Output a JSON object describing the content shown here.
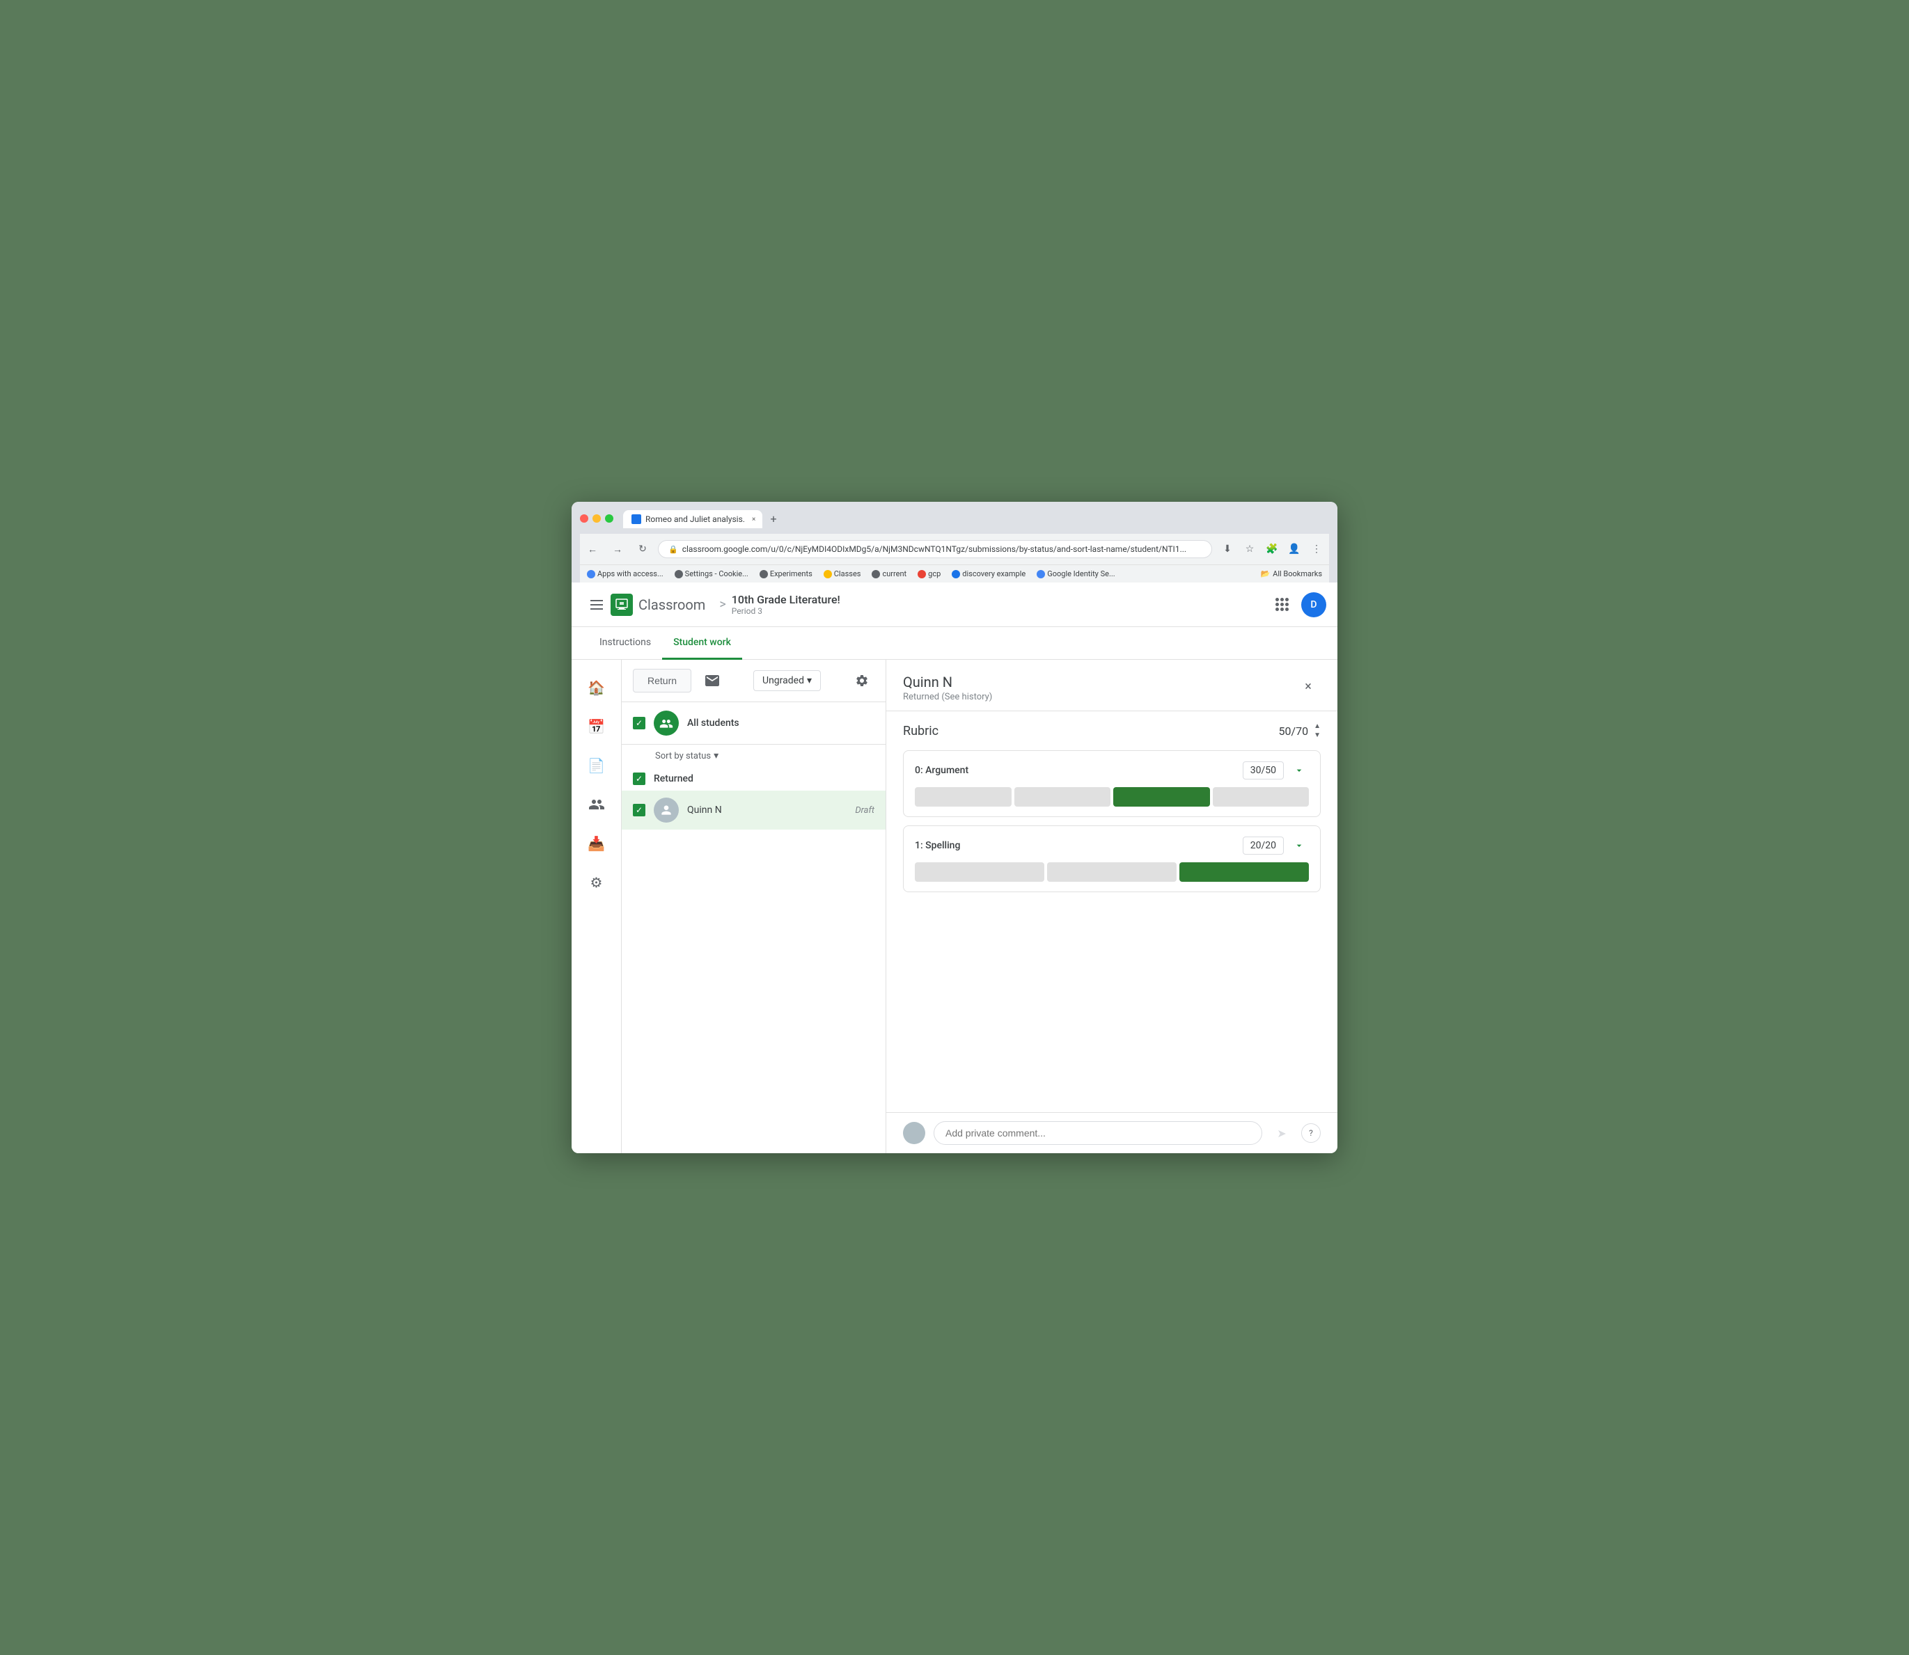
{
  "browser": {
    "tab_title": "Romeo and Juliet analysis.",
    "tab_close": "×",
    "new_tab": "+",
    "url": "classroom.google.com/u/0/c/NjEyMDI4ODIxMDg5/a/NjM3NDcwNTQ1NTgz/submissions/by-status/and-sort-last-name/student/NTI1...",
    "back_btn": "←",
    "forward_btn": "→",
    "refresh_btn": "↻",
    "bookmarks": [
      {
        "label": "Apps with access...",
        "color": "#4285f4"
      },
      {
        "label": "Settings - Cookie...",
        "color": "#5f6368"
      },
      {
        "label": "Experiments",
        "color": "#5f6368"
      },
      {
        "label": "Classes",
        "color": "#fbbc04"
      },
      {
        "label": "current",
        "color": "#5f6368"
      },
      {
        "label": "gcp",
        "color": "#ea4335"
      },
      {
        "label": "discovery example",
        "color": "#1a73e8"
      },
      {
        "label": "Google Identity Se...",
        "color": "#4285f4"
      }
    ],
    "all_bookmarks": "All Bookmarks"
  },
  "app_bar": {
    "app_name": "Classroom",
    "breadcrumb_separator": ">",
    "course_name": "10th Grade Literature!",
    "course_period": "Period 3",
    "user_initial": "D"
  },
  "tabs": [
    {
      "label": "Instructions",
      "active": false
    },
    {
      "label": "Student work",
      "active": true
    }
  ],
  "toolbar": {
    "return_label": "Return",
    "email_icon": "✉",
    "grade_label": "Ungraded",
    "dropdown_icon": "▾",
    "settings_icon": "⚙"
  },
  "student_list": {
    "all_students_label": "All students",
    "sort_label": "Sort by status",
    "sort_icon": "▾",
    "section_returned": "Returned",
    "students": [
      {
        "name": "Quinn N",
        "status": "Draft",
        "selected": true
      }
    ]
  },
  "detail": {
    "student_name": "Quinn N",
    "student_status": "Returned (See history)",
    "close_icon": "×",
    "rubric_title": "Rubric",
    "rubric_score": "50",
    "rubric_total": "70",
    "criteria": [
      {
        "name": "0: Argument",
        "score": "30",
        "total": "50",
        "bars": [
          "empty",
          "empty",
          "selected",
          "empty"
        ],
        "expanded": true
      },
      {
        "name": "1: Spelling",
        "score": "20",
        "total": "20",
        "bars": [
          "empty",
          "empty",
          "selected"
        ],
        "expanded": true
      }
    ]
  },
  "comment": {
    "placeholder": "Add private comment...",
    "send_icon": "➤",
    "help_icon": "?"
  },
  "side_nav": {
    "icons": [
      "🏠",
      "📅",
      "📄",
      "👤",
      "📥",
      "⚙"
    ]
  }
}
